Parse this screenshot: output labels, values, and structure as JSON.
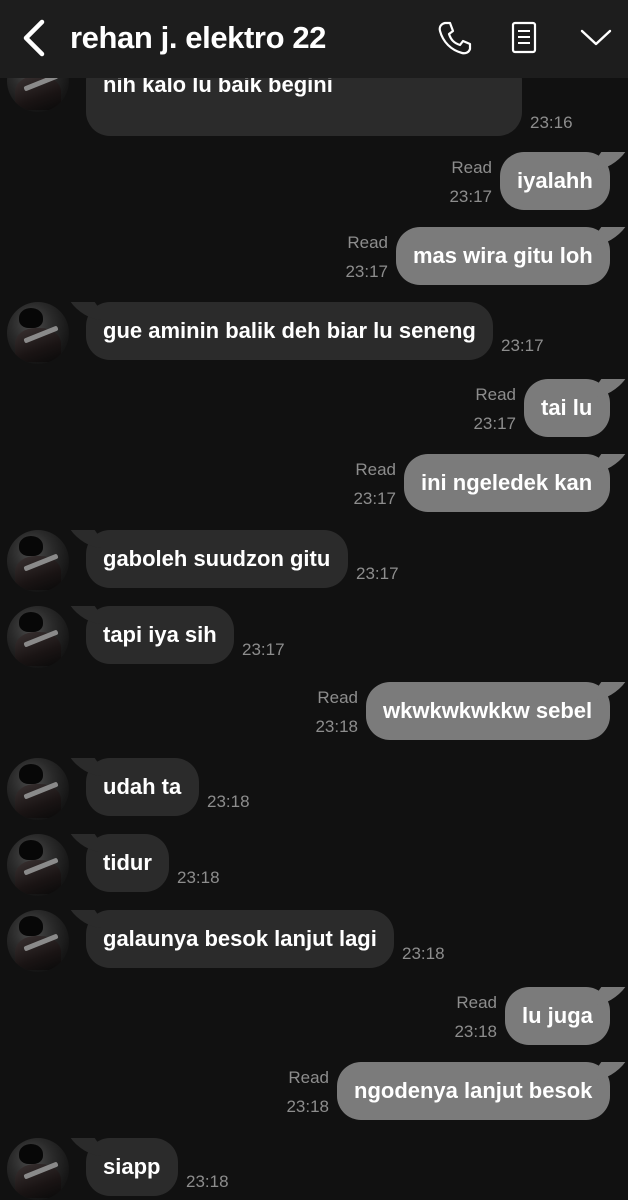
{
  "header": {
    "title": "rehan j. elektro 22",
    "icons": [
      "back-chevron-icon",
      "phone-icon",
      "notes-icon",
      "chevron-down-icon"
    ]
  },
  "first_message": {
    "partial_text": "nih kalo lu baik begini",
    "time": "23:16"
  },
  "messages": [
    {
      "dir": "out",
      "text": "iyalahh",
      "read": "Read",
      "time": "23:17"
    },
    {
      "dir": "out",
      "text": "mas wira gitu loh",
      "read": "Read",
      "time": "23:17"
    },
    {
      "dir": "in",
      "text": "gue aminin balik deh biar lu seneng",
      "time": "23:17"
    },
    {
      "dir": "out",
      "text": "tai lu",
      "read": "Read",
      "time": "23:17"
    },
    {
      "dir": "out",
      "text": "ini ngeledek kan",
      "read": "Read",
      "time": "23:17"
    },
    {
      "dir": "in",
      "text": "gaboleh suudzon gitu",
      "time": "23:17"
    },
    {
      "dir": "in",
      "text": "tapi iya sih",
      "time": "23:17"
    },
    {
      "dir": "out",
      "text": "wkwkwkwkkw sebel",
      "read": "Read",
      "time": "23:18"
    },
    {
      "dir": "in",
      "text": "udah ta",
      "time": "23:18"
    },
    {
      "dir": "in",
      "text": "tidur",
      "time": "23:18"
    },
    {
      "dir": "in",
      "text": "galaunya besok lanjut lagi",
      "time": "23:18"
    },
    {
      "dir": "out",
      "text": "lu juga",
      "read": "Read",
      "time": "23:18"
    },
    {
      "dir": "out",
      "text": "ngodenya lanjut besok",
      "read": "Read",
      "time": "23:18"
    },
    {
      "dir": "in",
      "text": "siapp",
      "time": "23:18"
    }
  ],
  "colors": {
    "background": "#111111",
    "header": "#1d1d1d",
    "incoming_bubble": "#2b2b2b",
    "outgoing_bubble": "#7b7b7b",
    "meta_text": "#8d8d8d"
  }
}
